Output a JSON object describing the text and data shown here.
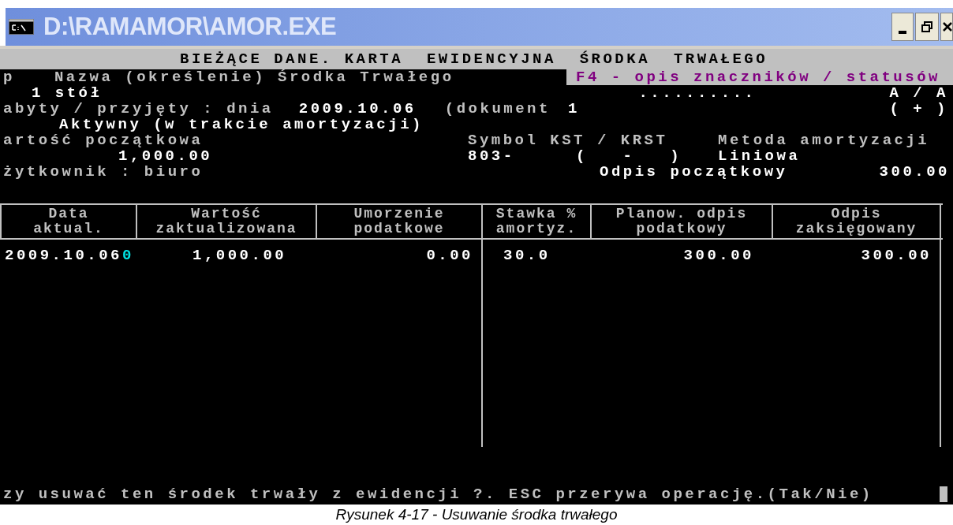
{
  "window": {
    "title": "D:\\RAMAMOR\\AMOR.EXE"
  },
  "console": {
    "heading": "BIEŻĄCE DANE. KARTA  EWIDENCYJNA  ŚRODKA  TRWAŁEGO",
    "lp_label": "p",
    "name_label": "Nazwa (określenie) Środka Trwałego",
    "hint": "F4 - opis znaczników / statusów",
    "item": "1 stół",
    "flags": "..........",
    "flag_codes": "A / A",
    "acquired_label": "abyty / przyjęty : dnia",
    "acquired_date": "2009.10.06",
    "document_label": "(dokument",
    "document_number": "1",
    "status_sign": "( + )",
    "status": "Aktywny (w trakcie amortyzacji)",
    "initial_value_label": "artość początkowa",
    "symbol_label": "Symbol KST / KRST",
    "method_label": "Metoda amortyzacji",
    "initial_value": "1,000.00",
    "symbol": "803-",
    "krst": "(   -   )",
    "method": "Liniowa",
    "user": "żytkownik : biuro",
    "initial_writeoff_label": "Odpis początkowy",
    "initial_writeoff": "300.00"
  },
  "table": {
    "columns": [
      {
        "label": "Data\naktual."
      },
      {
        "label": "Wartość\nzaktualizowana"
      },
      {
        "label": "Umorzenie\npodatkowe"
      },
      {
        "label": "Stawka %\namortyz."
      },
      {
        "label": "Planow. odpis\npodatkowy"
      },
      {
        "label": "Odpis\nzaksięgowany"
      }
    ],
    "rows": [
      {
        "cells": [
          "2009.10.06",
          "1,000.00",
          "0.00",
          "30.0",
          "300.00",
          "300.00"
        ],
        "marker": "0"
      }
    ]
  },
  "prompt": "zy usuwać ten środek trwały z ewidencji ?. ESC przerywa operację.(Tak/Nie)",
  "caption": "Rysunek 4-17 - Usuwanie środka trwałego"
}
